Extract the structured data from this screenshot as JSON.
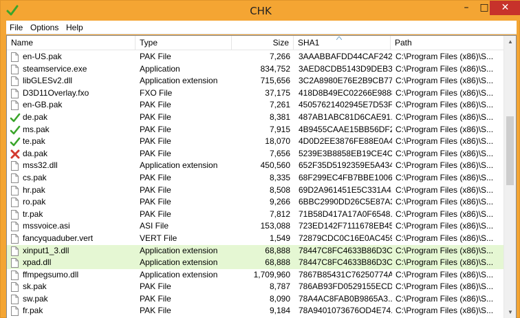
{
  "window": {
    "title": "CHK"
  },
  "titlebar": {
    "minimize": "–",
    "maximize": "□",
    "close": "✕"
  },
  "menu": [
    "File",
    "Options",
    "Help"
  ],
  "columns": {
    "name": "Name",
    "type": "Type",
    "size": "Size",
    "sha1": "SHA1",
    "path": "Path"
  },
  "rows": [
    {
      "name": "en-US.pak",
      "type": "PAK File",
      "size": "7,266",
      "sha1": "3AAABBAFDD44CAF242...",
      "path": "C:\\Program Files (x86)\\S...",
      "icon": "file-icon"
    },
    {
      "name": "steamservice.exe",
      "type": "Application",
      "size": "834,752",
      "sha1": "3AED8CDB5143D9DEB3...",
      "path": "C:\\Program Files (x86)\\S...",
      "icon": "file-icon"
    },
    {
      "name": "libGLESv2.dll",
      "type": "Application extension",
      "size": "715,656",
      "sha1": "3C2A8980E76E2B9CB77...",
      "path": "C:\\Program Files (x86)\\S...",
      "icon": "file-icon"
    },
    {
      "name": "D3D11Overlay.fxo",
      "type": "FXO File",
      "size": "37,175",
      "sha1": "418D8B49EC02266E9888...",
      "path": "C:\\Program Files (x86)\\S...",
      "icon": "file-icon"
    },
    {
      "name": "en-GB.pak",
      "type": "PAK File",
      "size": "7,261",
      "sha1": "45057621402945E7D53F...",
      "path": "C:\\Program Files (x86)\\S...",
      "icon": "file-icon"
    },
    {
      "name": "de.pak",
      "type": "PAK File",
      "size": "8,381",
      "sha1": "487AB1ABC81D6CAE91...",
      "path": "C:\\Program Files (x86)\\S...",
      "icon": "check-icon"
    },
    {
      "name": "ms.pak",
      "type": "PAK File",
      "size": "7,915",
      "sha1": "4B9455CAAE15BB56DF2...",
      "path": "C:\\Program Files (x86)\\S...",
      "icon": "check-icon"
    },
    {
      "name": "te.pak",
      "type": "PAK File",
      "size": "18,070",
      "sha1": "4D0D2EE3876FE88E0A45...",
      "path": "C:\\Program Files (x86)\\S...",
      "icon": "check-icon"
    },
    {
      "name": "da.pak",
      "type": "PAK File",
      "size": "7,656",
      "sha1": "5239E3B8858EB19CE4C2...",
      "path": "C:\\Program Files (x86)\\S...",
      "icon": "cross-icon"
    },
    {
      "name": "mss32.dll",
      "type": "Application extension",
      "size": "450,560",
      "sha1": "652F35D5192359E5A434...",
      "path": "C:\\Program Files (x86)\\S...",
      "icon": "file-icon"
    },
    {
      "name": "cs.pak",
      "type": "PAK File",
      "size": "8,335",
      "sha1": "68F299EC4FB7BBE10067...",
      "path": "C:\\Program Files (x86)\\S...",
      "icon": "file-icon"
    },
    {
      "name": "hr.pak",
      "type": "PAK File",
      "size": "8,508",
      "sha1": "69D2A961451E5C331A4...",
      "path": "C:\\Program Files (x86)\\S...",
      "icon": "file-icon"
    },
    {
      "name": "ro.pak",
      "type": "PAK File",
      "size": "9,266",
      "sha1": "6BBC2990DD26C5E87A3...",
      "path": "C:\\Program Files (x86)\\S...",
      "icon": "file-icon"
    },
    {
      "name": "tr.pak",
      "type": "PAK File",
      "size": "7,812",
      "sha1": "71B58D417A17A0F6548...",
      "path": "C:\\Program Files (x86)\\S...",
      "icon": "file-icon"
    },
    {
      "name": "mssvoice.asi",
      "type": "ASI File",
      "size": "153,088",
      "sha1": "723ED142F7111678EB45...",
      "path": "C:\\Program Files (x86)\\S...",
      "icon": "file-icon"
    },
    {
      "name": "fancyquaduber.vert",
      "type": "VERT File",
      "size": "1,549",
      "sha1": "72879CDC0C16E0AC459...",
      "path": "C:\\Program Files (x86)\\S...",
      "icon": "file-icon"
    },
    {
      "name": "xinput1_3.dll",
      "type": "Application extension",
      "size": "68,888",
      "sha1": "78447C8FC4633B86D3C...",
      "path": "C:\\Program Files (x86)\\S...",
      "icon": "file-icon",
      "highlight": true
    },
    {
      "name": "xpad.dll",
      "type": "Application extension",
      "size": "68,888",
      "sha1": "78447C8FC4633B86D3C...",
      "path": "C:\\Program Files (x86)\\S...",
      "icon": "file-icon",
      "highlight": true
    },
    {
      "name": "ffmpegsumo.dll",
      "type": "Application extension",
      "size": "1,709,960",
      "sha1": "7867B85431C76250774A...",
      "path": "C:\\Program Files (x86)\\S...",
      "icon": "file-icon"
    },
    {
      "name": "sk.pak",
      "type": "PAK File",
      "size": "8,787",
      "sha1": "786AB93FD0529155ECD...",
      "path": "C:\\Program Files (x86)\\S...",
      "icon": "file-icon"
    },
    {
      "name": "sw.pak",
      "type": "PAK File",
      "size": "8,090",
      "sha1": "78A4AC8FAB0B9865A3...",
      "path": "C:\\Program Files (x86)\\S...",
      "icon": "file-icon"
    },
    {
      "name": "fr.pak",
      "type": "PAK File",
      "size": "9,184",
      "sha1": "78A9401073676OD4E74...",
      "path": "C:\\Program Files (x86)\\S...",
      "icon": "file-icon"
    }
  ],
  "colors": {
    "accent_title": "#f4a533",
    "close_button": "#c7322b",
    "highlight_row": "#e5f7d3",
    "check": "#3aa52b",
    "cross": "#d33a2f"
  },
  "scrollbar": {
    "up": "▲",
    "down": "▼"
  }
}
